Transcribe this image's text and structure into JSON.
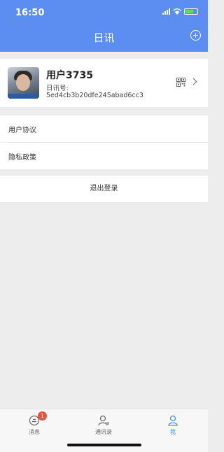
{
  "status_bar": {
    "time": "16:50",
    "icons": [
      "signal-icon",
      "wifi-icon",
      "battery-icon"
    ]
  },
  "nav": {
    "title": "日讯",
    "add_icon": "plus-circle-icon"
  },
  "profile": {
    "username": "用户3735",
    "id_label": "日讯号:",
    "id_value": "5ed4cb3b20dfe245abad6cc3",
    "qr_icon": "qr-code-icon"
  },
  "menu": [
    {
      "label": "用户协议"
    },
    {
      "label": "隐私政策"
    }
  ],
  "logout_label": "退出登录",
  "tabbar": [
    {
      "label": "消息",
      "icon": "message-icon",
      "badge": "1"
    },
    {
      "label": "通讯录",
      "icon": "contacts-icon"
    },
    {
      "label": "我",
      "icon": "profile-icon",
      "active": true
    }
  ],
  "colors": {
    "header": "#5b8ef0",
    "active_tab": "#4a8fe0",
    "badge": "#e8533f"
  }
}
